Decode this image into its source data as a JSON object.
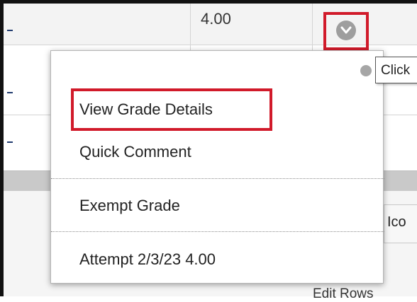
{
  "grid": {
    "row1_score": "4.00"
  },
  "tooltip": {
    "text": "Click"
  },
  "menu": {
    "items": [
      {
        "label": "View Grade Details"
      },
      {
        "label": "Quick Comment"
      },
      {
        "label": "Exempt Grade"
      },
      {
        "label": "Attempt 2/3/23 4.00"
      }
    ]
  },
  "background": {
    "side_button_label": "Ico",
    "edit_rows_label": "Edit Rows"
  },
  "icons": {
    "row_menu_button": "chevron-down-circle-icon",
    "small_menu_button": "chevron-down-circle-icon"
  },
  "colors": {
    "annotation_red": "#d11a2a",
    "chevron_grey": "#9e9e9e",
    "header_band_grey": "#c9c9c9"
  }
}
